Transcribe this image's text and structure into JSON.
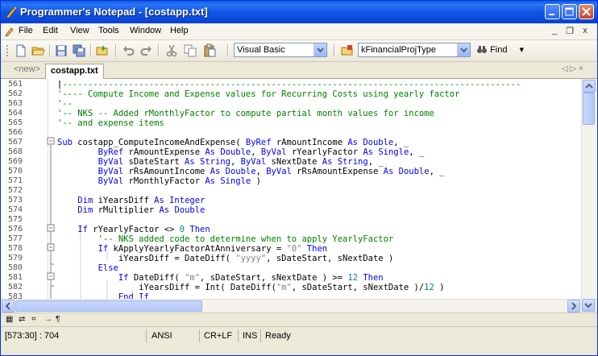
{
  "window": {
    "title": "Programmer's Notepad - [costapp.txt]"
  },
  "menu": {
    "items": [
      "File",
      "Edit",
      "View",
      "Tools",
      "Window",
      "Help"
    ],
    "mdi_buttons": [
      "_",
      "❐",
      "x"
    ]
  },
  "toolbar": {
    "scheme_select": "Visual Basic",
    "function_select": "kFinancialProjType",
    "find_label": "Find"
  },
  "tabs": {
    "new_tab": "<new>",
    "active_tab": "costapp.txt",
    "nav": "◁ ▷ ×"
  },
  "editor": {
    "lines": [
      {
        "n": "561",
        "tokens": [
          [
            "c",
            "'------------------------------------------------------------------------------------------"
          ]
        ]
      },
      {
        "n": "562",
        "tokens": [
          [
            "c",
            "'---- Compute Income and Expense values for Recurring Costs using yearly factor"
          ]
        ]
      },
      {
        "n": "563",
        "tokens": [
          [
            "c",
            "'--"
          ]
        ]
      },
      {
        "n": "564",
        "tokens": [
          [
            "c",
            "'-- NKS -- Added rMonthlyFactor to compute partial month values for income"
          ]
        ]
      },
      {
        "n": "565",
        "tokens": [
          [
            "c",
            "'-- and expense items"
          ]
        ]
      },
      {
        "n": "566",
        "tokens": []
      },
      {
        "n": "567",
        "tokens": [
          [
            "k",
            "Sub"
          ],
          [
            "t",
            " costapp_ComputeIncomeAndExpense( "
          ],
          [
            "k",
            "ByRef"
          ],
          [
            "t",
            " rAmountIncome "
          ],
          [
            "k",
            "As"
          ],
          [
            "t",
            " "
          ],
          [
            "k",
            "Double"
          ],
          [
            "t",
            ", _"
          ]
        ]
      },
      {
        "n": "568",
        "tokens": [
          [
            "t",
            "        "
          ],
          [
            "k",
            "ByRef"
          ],
          [
            "t",
            " rAmountExpense "
          ],
          [
            "k",
            "As"
          ],
          [
            "t",
            " "
          ],
          [
            "k",
            "Double"
          ],
          [
            "t",
            ", "
          ],
          [
            "k",
            "ByVal"
          ],
          [
            "t",
            " rYearlyFactor "
          ],
          [
            "k",
            "As"
          ],
          [
            "t",
            " "
          ],
          [
            "k",
            "Single"
          ],
          [
            "t",
            ", _"
          ]
        ]
      },
      {
        "n": "569",
        "tokens": [
          [
            "t",
            "        "
          ],
          [
            "k",
            "ByVal"
          ],
          [
            "t",
            " sDateStart "
          ],
          [
            "k",
            "As"
          ],
          [
            "t",
            " "
          ],
          [
            "k",
            "String"
          ],
          [
            "t",
            ", "
          ],
          [
            "k",
            "ByVal"
          ],
          [
            "t",
            " sNextDate "
          ],
          [
            "k",
            "As"
          ],
          [
            "t",
            " "
          ],
          [
            "k",
            "String"
          ],
          [
            "t",
            ", _"
          ]
        ]
      },
      {
        "n": "570",
        "tokens": [
          [
            "t",
            "        "
          ],
          [
            "k",
            "ByVal"
          ],
          [
            "t",
            " rRsAmountIncome "
          ],
          [
            "k",
            "As"
          ],
          [
            "t",
            " "
          ],
          [
            "k",
            "Double"
          ],
          [
            "t",
            ", "
          ],
          [
            "k",
            "ByVal"
          ],
          [
            "t",
            " rRsAmountExpense "
          ],
          [
            "k",
            "As"
          ],
          [
            "t",
            " "
          ],
          [
            "k",
            "Double"
          ],
          [
            "t",
            ", _"
          ]
        ]
      },
      {
        "n": "571",
        "tokens": [
          [
            "t",
            "        "
          ],
          [
            "k",
            "ByVal"
          ],
          [
            "t",
            " rMonthlyFactor "
          ],
          [
            "k",
            "As"
          ],
          [
            "t",
            " "
          ],
          [
            "k",
            "Single"
          ],
          [
            "t",
            " )"
          ]
        ]
      },
      {
        "n": "572",
        "tokens": []
      },
      {
        "n": "573",
        "tokens": [
          [
            "t",
            "    "
          ],
          [
            "k",
            "Dim"
          ],
          [
            "t",
            " iYearsDiff "
          ],
          [
            "k",
            "As"
          ],
          [
            "t",
            " "
          ],
          [
            "k",
            "Integer"
          ]
        ]
      },
      {
        "n": "574",
        "tokens": [
          [
            "t",
            "    "
          ],
          [
            "k",
            "Dim"
          ],
          [
            "t",
            " rMultiplier "
          ],
          [
            "k",
            "As"
          ],
          [
            "t",
            " "
          ],
          [
            "k",
            "Double"
          ]
        ]
      },
      {
        "n": "575",
        "tokens": []
      },
      {
        "n": "576",
        "tokens": [
          [
            "t",
            "    "
          ],
          [
            "k",
            "If"
          ],
          [
            "t",
            " rYearlyFactor <> "
          ],
          [
            "n",
            "0"
          ],
          [
            "t",
            " "
          ],
          [
            "k",
            "Then"
          ]
        ]
      },
      {
        "n": "577",
        "tokens": [
          [
            "t",
            "        "
          ],
          [
            "c",
            "'-- NKS added code to determine when to apply YearlyFactor"
          ]
        ]
      },
      {
        "n": "578",
        "tokens": [
          [
            "t",
            "        "
          ],
          [
            "k",
            "If"
          ],
          [
            "t",
            " kApplyYearlyFactorAtAnniversary = "
          ],
          [
            "s",
            "\"0\""
          ],
          [
            "t",
            " "
          ],
          [
            "k",
            "Then"
          ]
        ]
      },
      {
        "n": "579",
        "tokens": [
          [
            "t",
            "            iYearsDiff = DateDiff( "
          ],
          [
            "s",
            "\"yyyy\""
          ],
          [
            "t",
            ", sDateStart, sNextDate )"
          ]
        ]
      },
      {
        "n": "580",
        "tokens": [
          [
            "t",
            "        "
          ],
          [
            "k",
            "Else"
          ]
        ]
      },
      {
        "n": "581",
        "tokens": [
          [
            "t",
            "            "
          ],
          [
            "k",
            "If"
          ],
          [
            "t",
            " DateDiff( "
          ],
          [
            "s",
            "\"m\""
          ],
          [
            "t",
            ", sDateStart, sNextDate ) >= "
          ],
          [
            "n",
            "12"
          ],
          [
            "t",
            " "
          ],
          [
            "k",
            "Then"
          ]
        ]
      },
      {
        "n": "582",
        "tokens": [
          [
            "t",
            "                iYearsDiff = Int( DateDiff("
          ],
          [
            "s",
            "\"m\""
          ],
          [
            "t",
            ", sDateStart, sNextDate )/"
          ],
          [
            "n",
            "12"
          ],
          [
            "t",
            " )"
          ]
        ]
      },
      {
        "n": "583",
        "tokens": [
          [
            "t",
            "            "
          ],
          [
            "k",
            "End"
          ],
          [
            "t",
            " "
          ],
          [
            "k",
            "If"
          ]
        ]
      }
    ]
  },
  "bottom_toolbar": {
    "items": [
      "▦",
      "⇄",
      "⌗",
      "→",
      "¶"
    ]
  },
  "status": {
    "position": "[573:30] : 704",
    "encoding": "ANSI",
    "line_endings": "CR+LF",
    "insert_mode": "INS",
    "state": "Ready"
  }
}
